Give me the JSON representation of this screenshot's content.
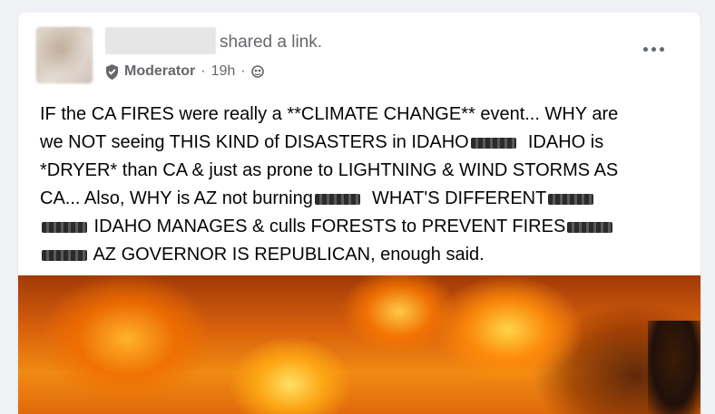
{
  "post": {
    "author_action": "shared a link.",
    "role": "Moderator",
    "time": "19h",
    "separator": "·",
    "lines": [
      {
        "segments": [
          "IF the CA FIRES were really a **CLIMATE CHANGE** event... WHY are"
        ]
      },
      {
        "segments": [
          "we NOT seeing THIS KIND of DISASTERS in IDAHO",
          "EMOJI",
          "  IDAHO is"
        ]
      },
      {
        "segments": [
          "*DRYER* than CA & just as prone to LIGHTNING & WIND STORMS AS"
        ]
      },
      {
        "segments": [
          "CA... Also, WHY is AZ not burning",
          "EMOJI",
          "  WHAT'S DIFFERENT",
          "EMOJI"
        ]
      },
      {
        "segments": [
          "EMOJI",
          " IDAHO MANAGES & culls FORESTS to PREVENT FIRES",
          "EMOJI"
        ]
      },
      {
        "segments": [
          "EMOJI",
          " AZ GOVERNOR IS REPUBLICAN, enough said."
        ]
      }
    ]
  },
  "icons": {
    "shield": "shield-icon",
    "globe": "globe-icon",
    "more": "more-options-icon"
  }
}
